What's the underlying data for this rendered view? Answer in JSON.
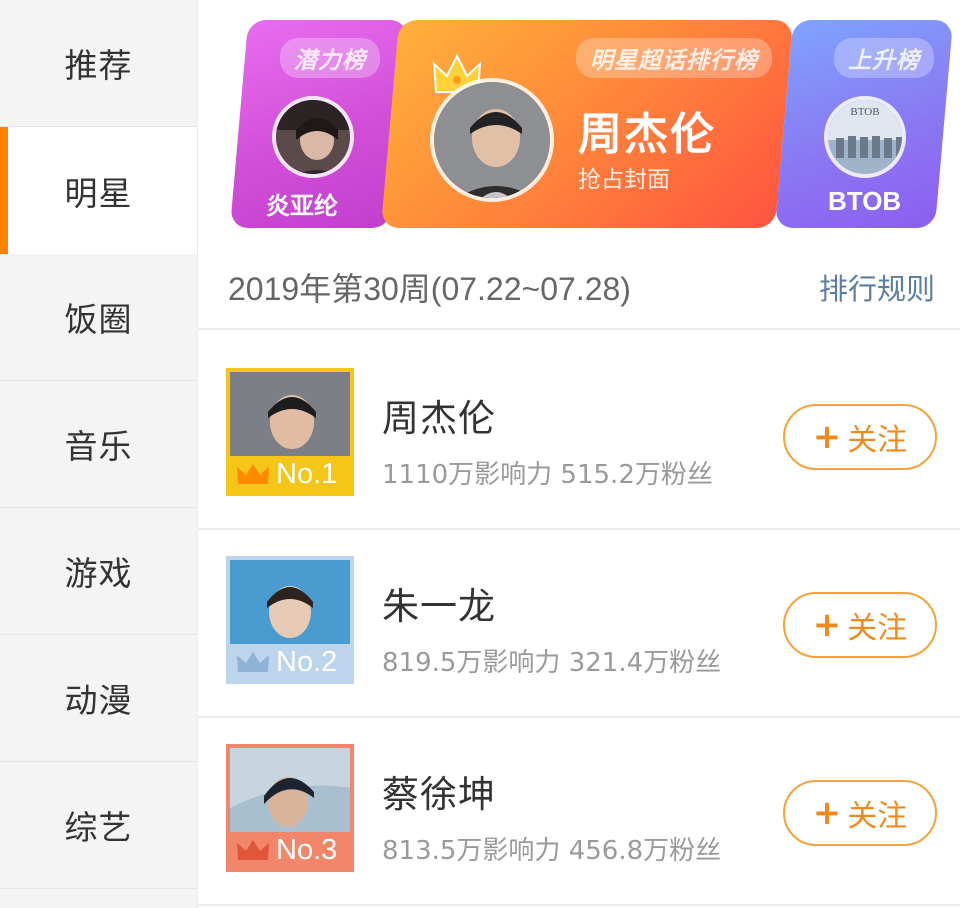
{
  "sidebar": {
    "items": [
      {
        "label": "推荐"
      },
      {
        "label": "明星"
      },
      {
        "label": "饭圈"
      },
      {
        "label": "音乐"
      },
      {
        "label": "游戏"
      },
      {
        "label": "动漫"
      },
      {
        "label": "综艺"
      }
    ],
    "active_index": 1
  },
  "banners": {
    "left": {
      "tag": "潜力榜",
      "name": "炎亚纶"
    },
    "center": {
      "tag": "明星超话排行榜",
      "name": "周杰伦",
      "subtitle": "抢占封面"
    },
    "right": {
      "tag": "上升榜",
      "name": "BTOB",
      "image_text": "BTOB"
    }
  },
  "ranking": {
    "week_title": "2019年第30周(07.22~07.28)",
    "rule_link": "排行规则",
    "rows": [
      {
        "rank": "No.1",
        "name": "周杰伦",
        "stats": "1110万影响力 515.2万粉丝",
        "follow": "关注"
      },
      {
        "rank": "No.2",
        "name": "朱一龙",
        "stats": "819.5万影响力 321.4万粉丝",
        "follow": "关注"
      },
      {
        "rank": "No.3",
        "name": "蔡徐坤",
        "stats": "813.5万影响力 456.8万粉丝",
        "follow": "关注"
      }
    ]
  },
  "colors": {
    "accent": "#ff8200",
    "rank1": "#f5c518",
    "rank2": "#bcd4ec",
    "rank3": "#f2866a"
  }
}
